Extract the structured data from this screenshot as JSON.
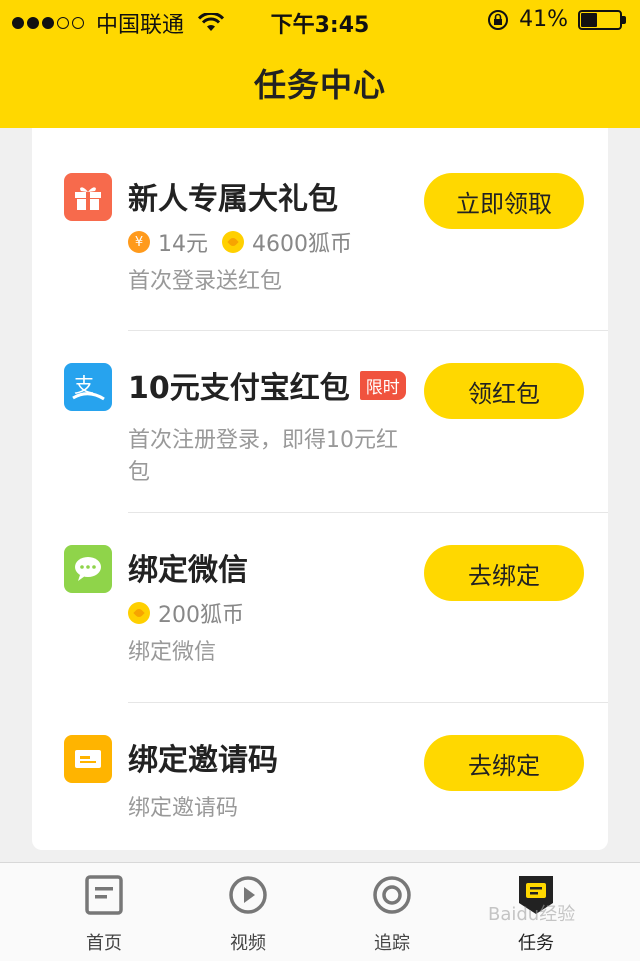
{
  "status_bar": {
    "carrier": "中国联通",
    "time": "下午3:45",
    "battery": "41%",
    "battery_level": 0.41
  },
  "header": {
    "title": "任务中心"
  },
  "tasks": [
    {
      "icon": "gift-icon",
      "icon_color": "#f76a4c",
      "title": "新人专属大礼包",
      "reward_yuan": "14元",
      "reward_coins": "4600狐币",
      "desc": "首次登录送红包",
      "button": "立即领取"
    },
    {
      "icon": "alipay-icon",
      "icon_color": "#27a3ee",
      "title": "10元支付宝红包",
      "badge": "限时",
      "desc": "首次注册登录，即得10元红包",
      "button": "领红包"
    },
    {
      "icon": "wechat-icon",
      "icon_color": "#8fd44a",
      "title": "绑定微信",
      "reward_coins": "200狐币",
      "desc": "绑定微信",
      "button": "去绑定"
    },
    {
      "icon": "invite-code-icon",
      "icon_color": "#ffb400",
      "title": "绑定邀请码",
      "desc": "绑定邀请码",
      "button": "去绑定"
    }
  ],
  "tabbar": [
    {
      "label": "首页",
      "icon": "home-doc-icon"
    },
    {
      "label": "视频",
      "icon": "video-play-icon"
    },
    {
      "label": "追踪",
      "icon": "track-target-icon"
    },
    {
      "label": "任务",
      "icon": "task-icon",
      "active": true
    }
  ],
  "watermark": "Baidu经验",
  "colors": {
    "accent": "#ffd800",
    "badge": "#f0533e"
  }
}
